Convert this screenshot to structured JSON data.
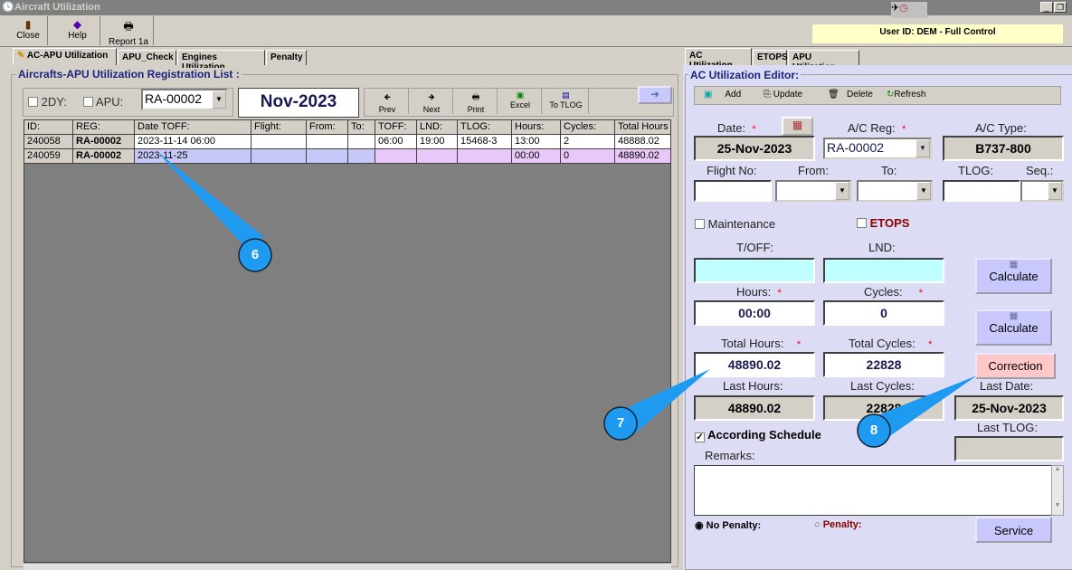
{
  "window": {
    "title": "Aircraft Utilization"
  },
  "toolbar": {
    "close": "Close",
    "help": "Help",
    "report": "Report 1a"
  },
  "user_info": "User ID: DEM - Full Control",
  "left_tabs": [
    "AC-APU Utilization",
    "APU_Check",
    "Engines Utilization",
    "Penalty"
  ],
  "left": {
    "group_title": "Aircrafts-APU Utilization Registration List :",
    "chk_2dy": "2DY:",
    "chk_apu": "APU:",
    "reg": "RA-00002",
    "month": "Nov-2023",
    "nav": {
      "prev": "Prev",
      "next": "Next",
      "print": "Print",
      "excel": "Excel",
      "to_tlog": "To TLOG"
    },
    "columns": [
      "ID:",
      "REG:",
      "Date TOFF:",
      "Flight:",
      "From:",
      "To:",
      "TOFF:",
      "LND:",
      "TLOG:",
      "Hours:",
      "Cycles:",
      "Total Hours"
    ],
    "rows": [
      [
        "240058",
        "RA-00002",
        "2023-11-14 06:00",
        "",
        "",
        "",
        "06:00",
        "19:00",
        "15468-3",
        "13:00",
        "2",
        "48888.02"
      ],
      [
        "240059",
        "RA-00002",
        "2023-11-25",
        "",
        "",
        "",
        "",
        "",
        "",
        "00:00",
        "0",
        "48890.02"
      ]
    ]
  },
  "right_tabs": [
    "AC Utilization",
    "ETOPS",
    "APU Utilization"
  ],
  "editor": {
    "title": "AC Utilization Editor:",
    "toolbar": {
      "add": "Add",
      "update": "Update",
      "delete": "Delete",
      "refresh": "Refresh"
    },
    "date_label": "Date:",
    "date": "25-Nov-2023",
    "reg_label": "A/C Reg:",
    "reg": "RA-00002",
    "type_label": "A/C Type:",
    "type": "B737-800",
    "flight_label": "Flight No:",
    "from_label": "From:",
    "to_label": "To:",
    "tlog_label": "TLOG:",
    "seq_label": "Seq.:",
    "maintenance": "Maintenance",
    "etops": "ETOPS",
    "toff_label": "T/OFF:",
    "lnd_label": "LND:",
    "calculate": "Calculate",
    "hours_label": "Hours:",
    "hours": "00:00",
    "cycles_label": "Cycles:",
    "cycles": "0",
    "total_hours_label": "Total Hours:",
    "total_hours": "48890.02",
    "total_cycles_label": "Total Cycles:",
    "total_cycles": "22828",
    "correction": "Correction",
    "last_hours_label": "Last Hours:",
    "last_hours": "48890.02",
    "last_cycles_label": "Last Cycles:",
    "last_cycles": "22828",
    "last_date_label": "Last Date:",
    "last_date": "25-Nov-2023",
    "last_tlog_label": "Last TLOG:",
    "according_schedule": "According Schedule",
    "remarks_label": "Remarks:",
    "no_penalty": "No Penalty:",
    "penalty": "Penalty:",
    "service": "Service"
  },
  "callouts": [
    "6",
    "7",
    "8"
  ],
  "colors": {
    "callout": "#1e9bf0",
    "selected_row": "#c8c8f8",
    "pink_row": "#e8c8f8",
    "panel": "#dcdcf4",
    "correction": "#ffc8c8"
  }
}
